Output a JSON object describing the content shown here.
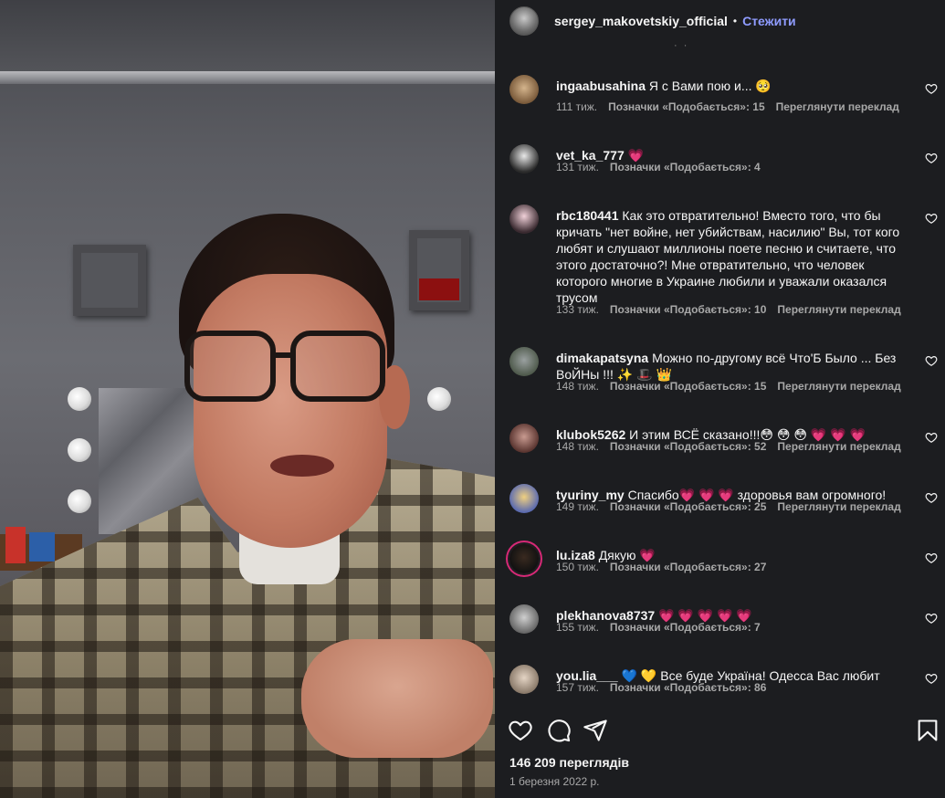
{
  "post": {
    "author": "sergey_makovetskiy_official",
    "separator": "•",
    "follow_label": "Стежити",
    "more_dots": "· ·"
  },
  "comments": [
    {
      "user": "ingaabusahina",
      "text": "Я с Вами пою и... 🥺",
      "time": "111 тиж.",
      "likes": "Позначки «Подобається»: 15",
      "translate": "Переглянути переклад"
    },
    {
      "user": "vet_ka_777",
      "text": "💗",
      "time": "131 тиж.",
      "likes": "Позначки «Подобається»: 4",
      "translate": ""
    },
    {
      "user": "rbc180441",
      "text": "Как это отвратительно! Вместо того, что бы кричать \"нет войне, нет убийствам, насилию\" Вы, тот кого любят и слушают миллионы поете песню и считаете, что этого достаточно?! Мне отвратительно, что человек которого многие в Украине любили и уважали оказался трусом",
      "time": "133 тиж.",
      "likes": "Позначки «Подобається»: 10",
      "translate": "Переглянути переклад"
    },
    {
      "user": "dimakapatsyna",
      "text": "Можно по-другому всё Что'Б Было ... Без ВоЙНы !!! ✨ 🎩 👑",
      "time": "148 тиж.",
      "likes": "Позначки «Подобається»: 15",
      "translate": "Переглянути переклад"
    },
    {
      "user": "klubok5262",
      "text": "И этим ВСЁ сказано!!!😳 😳 😳 💗 💗 💗",
      "time": "148 тиж.",
      "likes": "Позначки «Подобається»: 52",
      "translate": "Переглянути переклад"
    },
    {
      "user": "tyuriny_my",
      "text": "Спасибо💗 💗 💗 здоровья вам огромного!",
      "time": "149 тиж.",
      "likes": "Позначки «Подобається»: 25",
      "translate": "Переглянути переклад"
    },
    {
      "user": "lu.iza8",
      "text": "Дякую 💗",
      "time": "150 тиж.",
      "likes": "Позначки «Подобається»: 27",
      "translate": ""
    },
    {
      "user": "plekhanova8737",
      "text": "💗 💗 💗 💗 💗",
      "time": "155 тиж.",
      "likes": "Позначки «Подобається»: 7",
      "translate": ""
    },
    {
      "user": "you.lia___",
      "text": "💙 💛 Все буде Україна! Одесса Вас любит",
      "time": "157 тиж.",
      "likes": "Позначки «Подобається»: 86",
      "translate": ""
    }
  ],
  "stats": {
    "views": "146 209 переглядів",
    "date": "1 березня 2022 р."
  },
  "icons": {
    "like": "heart-icon",
    "comment": "comment-icon",
    "share": "send-icon",
    "save": "bookmark-icon"
  },
  "colors": {
    "panel_bg": "#1c1d20",
    "follow": "#8f9cff",
    "meta": "#a8a8a8"
  }
}
